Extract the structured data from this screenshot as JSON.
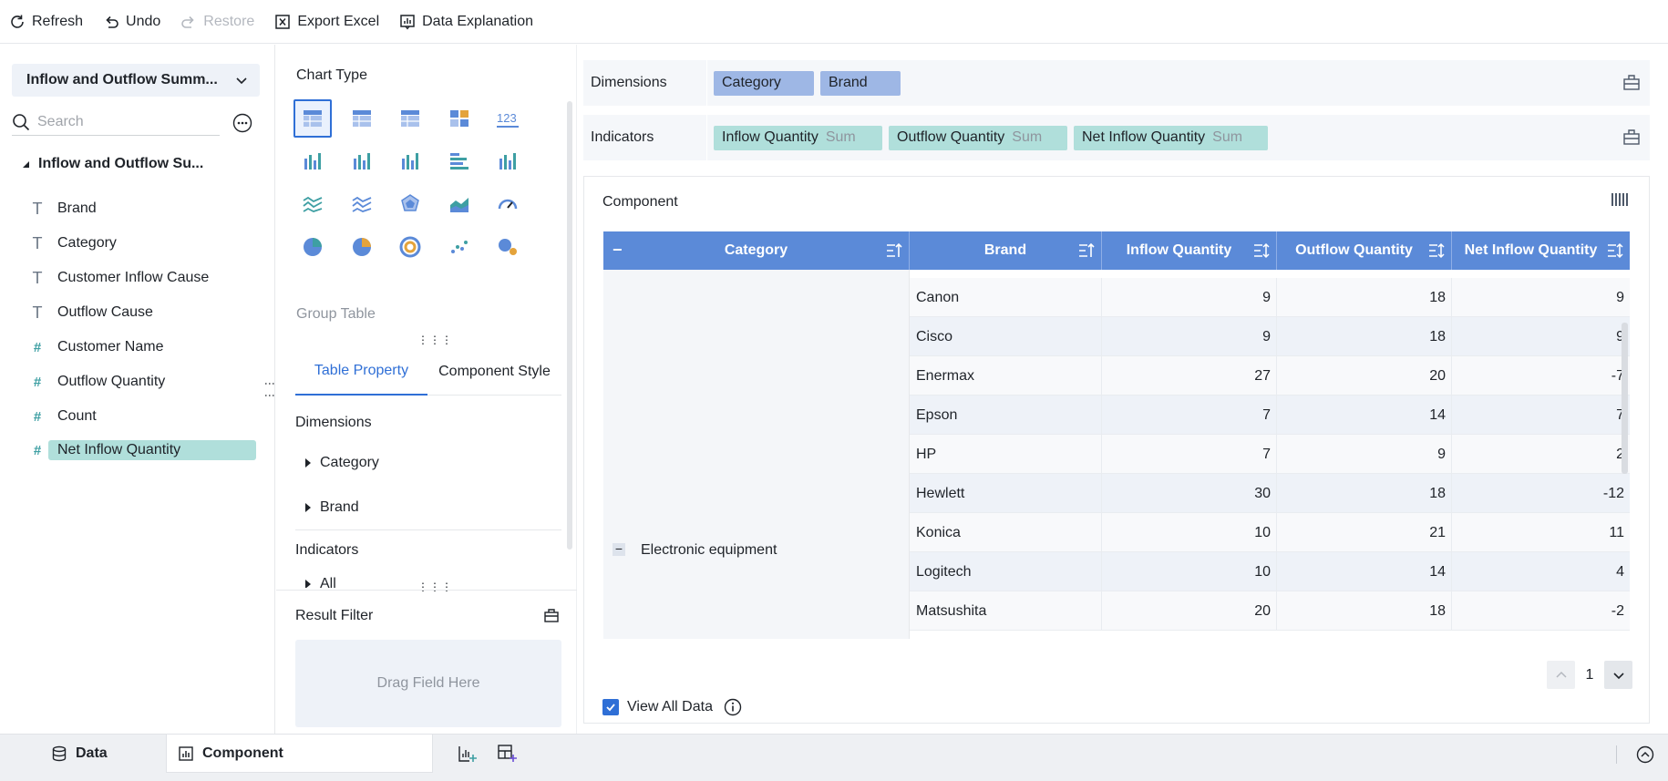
{
  "toolbar": {
    "refresh": "Refresh",
    "undo": "Undo",
    "restore": "Restore",
    "export_excel": "Export Excel",
    "data_explanation": "Data Explanation"
  },
  "left_panel": {
    "dataset_name": "Inflow and Outflow Summ...",
    "search_placeholder": "Search",
    "tree_root": "Inflow and Outflow Su...",
    "fields": [
      {
        "label": "Brand",
        "type": "text"
      },
      {
        "label": "Category",
        "type": "text"
      },
      {
        "label": "Customer Inflow Cause",
        "type": "text"
      },
      {
        "label": "Outflow Cause",
        "type": "text"
      },
      {
        "label": "Customer Name",
        "type": "number"
      },
      {
        "label": "Outflow Quantity",
        "type": "number"
      },
      {
        "label": "Count",
        "type": "number"
      },
      {
        "label": "Net Inflow Quantity",
        "type": "number",
        "selected": true
      }
    ]
  },
  "middle_panel": {
    "chart_type_title": "Chart Type",
    "selected_chart_type": "Group Table",
    "tabs": [
      "Table Property",
      "Component Style"
    ],
    "dimensions_title": "Dimensions",
    "dimension_items": [
      "Category",
      "Brand"
    ],
    "indicators_title": "Indicators",
    "indicator_items": [
      "All"
    ],
    "result_filter_title": "Result Filter",
    "drop_placeholder": "Drag Field Here"
  },
  "right_panel": {
    "dimensions_label": "Dimensions",
    "dimension_pills": [
      "Category",
      "Brand"
    ],
    "indicators_label": "Indicators",
    "indicator_pills": [
      {
        "name": "Inflow Quantity",
        "agg": "Sum"
      },
      {
        "name": "Outflow Quantity",
        "agg": "Sum"
      },
      {
        "name": "Net Inflow Quantity",
        "agg": "Sum"
      }
    ],
    "component_title": "Component",
    "table": {
      "columns": [
        "Category",
        "Brand",
        "Inflow Quantity",
        "Outflow Quantity",
        "Net Inflow Quantity"
      ],
      "group_label": "Electronic equipment",
      "rows": [
        [
          "Canon",
          "9",
          "18",
          "9"
        ],
        [
          "Cisco",
          "9",
          "18",
          "9"
        ],
        [
          "Enermax",
          "27",
          "20",
          "-7"
        ],
        [
          "Epson",
          "7",
          "14",
          "7"
        ],
        [
          "HP",
          "7",
          "9",
          "2"
        ],
        [
          "Hewlett",
          "30",
          "18",
          "-12"
        ],
        [
          "Konica",
          "10",
          "21",
          "11"
        ],
        [
          "Logitech",
          "10",
          "14",
          "4"
        ],
        [
          "Matsushita",
          "20",
          "18",
          "-2"
        ]
      ]
    },
    "page_number": "1",
    "view_all_data": "View All Data"
  },
  "bottom_bar": {
    "data_tab": "Data",
    "component_tab": "Component"
  },
  "colors": {
    "header_blue": "#5b8ad8",
    "accent_blue": "#2f6fd6",
    "dimension_pill": "#9eb7e5",
    "indicator_pill": "#b0dfdb"
  }
}
